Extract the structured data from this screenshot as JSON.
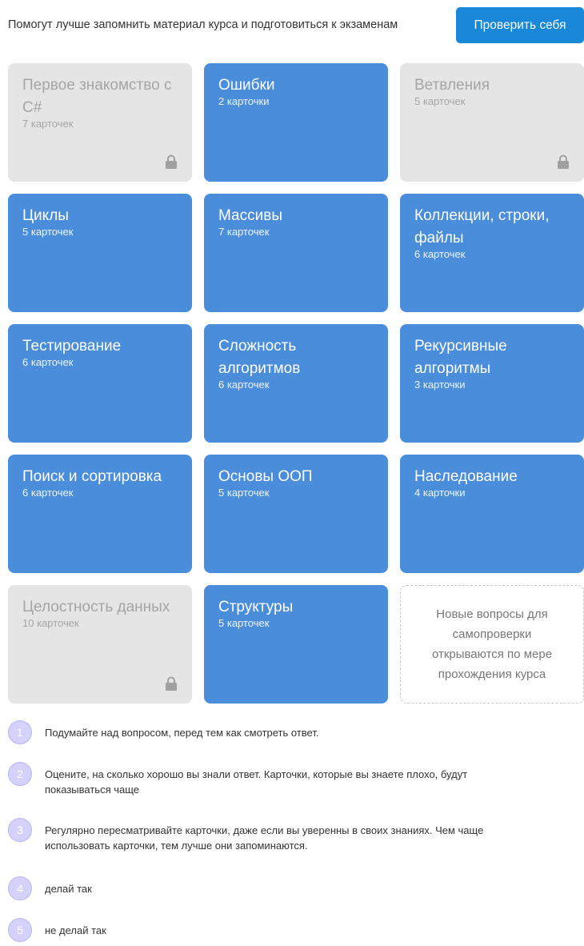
{
  "header": {
    "text": "Помогут лучше запомнить материал курса и подготовиться к экзаменам",
    "check_button": "Проверить себя"
  },
  "cards": [
    {
      "title": "Первое знакомство с C#",
      "count": "7 карточек",
      "locked": true
    },
    {
      "title": "Ошибки",
      "count": "2 карточки",
      "locked": false
    },
    {
      "title": "Ветвления",
      "count": "5 карточек",
      "locked": true
    },
    {
      "title": "Циклы",
      "count": "5 карточек",
      "locked": false
    },
    {
      "title": "Массивы",
      "count": "7 карточек",
      "locked": false
    },
    {
      "title": "Коллекции, строки, файлы",
      "count": "6 карточек",
      "locked": false
    },
    {
      "title": "Тестирование",
      "count": "6 карточек",
      "locked": false
    },
    {
      "title": "Сложность алгоритмов",
      "count": "6 карточек",
      "locked": false
    },
    {
      "title": "Рекурсивные алгоритмы",
      "count": "3 карточки",
      "locked": false
    },
    {
      "title": "Поиск и сортировка",
      "count": "6 карточек",
      "locked": false
    },
    {
      "title": "Основы ООП",
      "count": "5 карточек",
      "locked": false
    },
    {
      "title": "Наследование",
      "count": "4 карточки",
      "locked": false
    },
    {
      "title": "Целостность данных",
      "count": "10 карточек",
      "locked": true
    },
    {
      "title": "Структуры",
      "count": "5 карточек",
      "locked": false
    }
  ],
  "placeholder": {
    "text": "Новые вопросы для самопроверки открываются по мере прохождения курса"
  },
  "steps": [
    {
      "num": "1",
      "text": "Подумайте над вопросом, перед тем как смотреть ответ."
    },
    {
      "num": "2",
      "text": "Оцените, на сколько хорошо вы знали ответ. Карточки, которые вы знаете плохо, будут показываться чаще"
    },
    {
      "num": "3",
      "text": "Регулярно пересматривайте карточки, даже если вы уверенны в своих знаниях. Чем чаще использовать карточки, тем лучше они запоминаются."
    },
    {
      "num": "4",
      "text": "делай так"
    },
    {
      "num": "5",
      "text": "не делай так"
    }
  ],
  "colors": {
    "card_open": "#4a8ddb",
    "card_locked": "#e5e5e5",
    "button": "#1a88d8",
    "step_circle": "#d4d1fa"
  },
  "icons": {
    "locked_card": "lock-icon"
  }
}
